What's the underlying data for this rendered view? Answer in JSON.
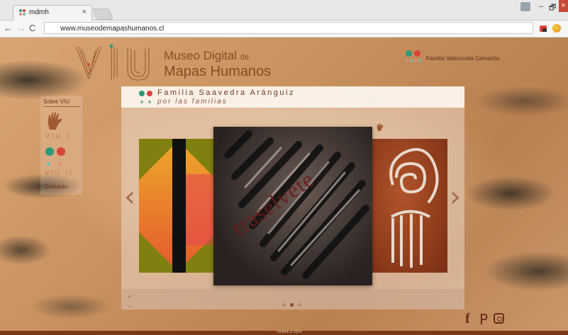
{
  "browser": {
    "tab_title": "mdmh",
    "tab_close": "×",
    "url": "www.museodemapashumanos.cl",
    "win_min": "–",
    "win_max": "🗗",
    "win_close": "×",
    "nav_back": "←",
    "nav_forward": "→",
    "nav_reload": "C"
  },
  "header": {
    "logo_text": "VIU",
    "title_line1": "Museo Digital",
    "title_de": "de",
    "title_line2": "Mapas Humanos",
    "family_label": "Familia Valenzuela Camacho"
  },
  "sidebar": {
    "sobre": "Sobre VIU",
    "viu1": "VIU I",
    "viu2": "VIU II",
    "contacto": "Contacto"
  },
  "panel": {
    "title": "Familia Saavedra Aránguiz",
    "subtitle": "por las familias",
    "center_slide_text": "traselvete",
    "arrow_left": "‹",
    "arrow_right": "›",
    "plus": "+",
    "minus": "–"
  },
  "social": {
    "facebook": "f",
    "pinterest": "P"
  },
  "footer": {
    "text": "©mdmh.cl 2014"
  },
  "colors": {
    "brand": "#8a4a26",
    "dot_green": "#2f9a78",
    "dot_red": "#d9443a",
    "dot_light_green": "#7ab8a6",
    "dot_light_red": "#e08a80"
  }
}
